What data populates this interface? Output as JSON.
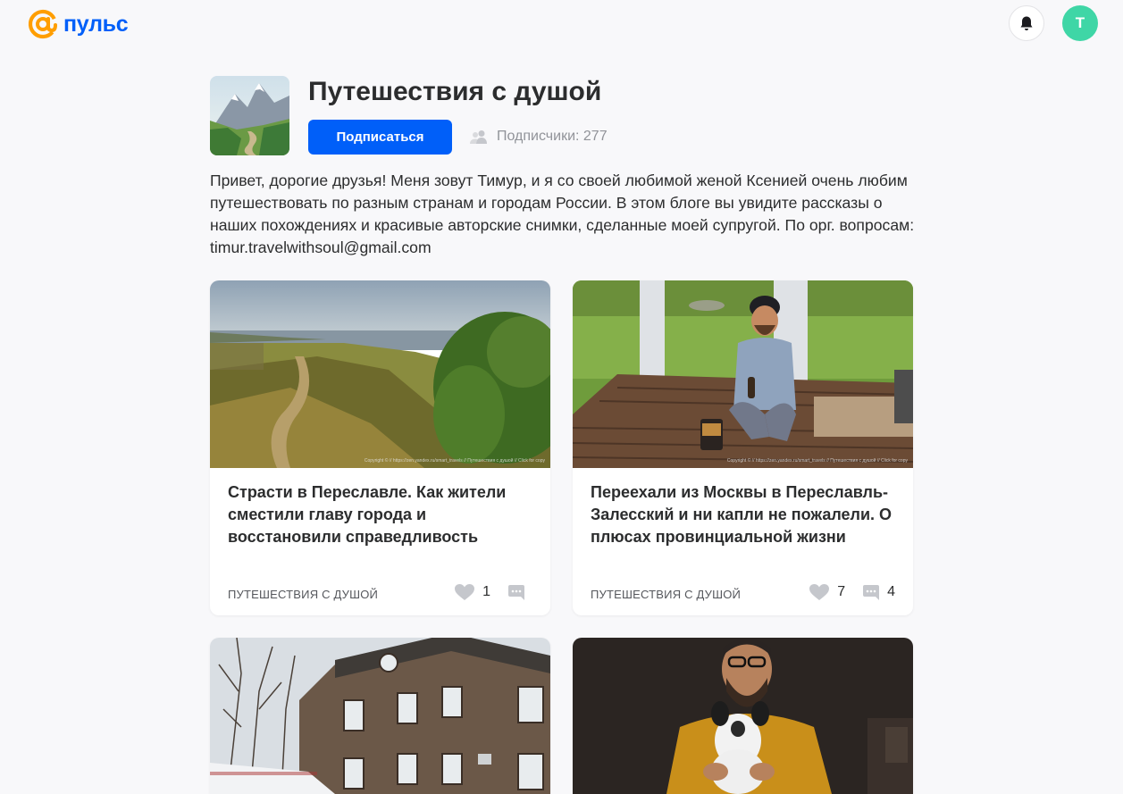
{
  "header": {
    "logo_text": "пульс",
    "avatar_letter": "Т",
    "icons": {
      "notifications": "bell-icon",
      "logo": "at-sign-icon"
    }
  },
  "channel": {
    "title": "Путешествия с душой",
    "subscribe_label": "Подписаться",
    "subscribers_text": "Подписчики: 277",
    "description": "Привет, дорогие друзья! Меня зовут Тимур, и я со своей любимой женой Ксенией очень любим путешествовать по разным странам и городам России. В этом блоге вы увидите рассказы о наших похождениях и красивые авторские снимки, сделанные моей супругой. По орг. вопросам: timur.travelwithsoul@gmail.com"
  },
  "articles": [
    {
      "title": "Страсти в Переславле. Как жители сместили главу города и восстановили справедливость",
      "source": "ПУТЕШЕСТВИЯ С ДУШОЙ",
      "likes": "1",
      "comments": "",
      "image_caption": "Copyright © // https://zen.yandex.ru/smart_travels // Путешествия с душой // Click for copy"
    },
    {
      "title": "Переехали из Москвы в Переславль-Залесский и ни капли не пожалели. О плюсах провинциальной жизни",
      "source": "ПУТЕШЕСТВИЯ С ДУШОЙ",
      "likes": "7",
      "comments": "4",
      "image_caption": "Copyright © // https://zen.yandex.ru/smart_travels // Путешествия с душой // Click for copy"
    },
    {
      "title": "",
      "source": "",
      "likes": "",
      "comments": ""
    },
    {
      "title": "",
      "source": "",
      "likes": "",
      "comments": ""
    }
  ],
  "colors": {
    "brand": "#005ff9",
    "accent": "#ff9e00",
    "avatar": "#3fd6a6",
    "background": "#f8f8fa"
  }
}
